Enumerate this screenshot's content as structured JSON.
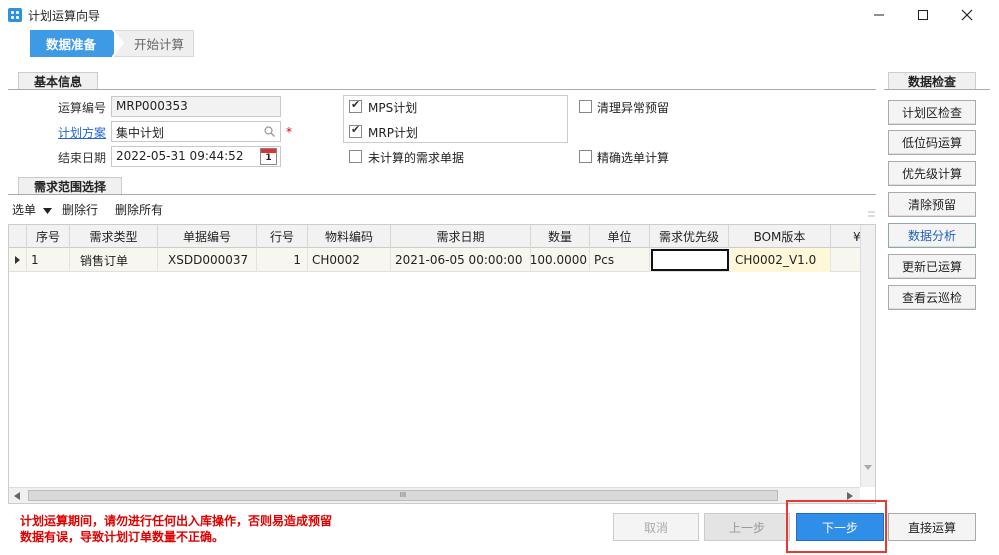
{
  "window": {
    "title": "计划运算向导",
    "min_icon": "minimize-icon",
    "max_icon": "maximize-icon",
    "close_icon": "close-icon"
  },
  "wizard": {
    "steps": [
      {
        "label": "数据准备",
        "active": true
      },
      {
        "label": "开始计算",
        "active": false
      }
    ]
  },
  "basic": {
    "section_title": "基本信息",
    "calc_no_label": "运算编号",
    "calc_no_value": "MRP000353",
    "plan_label": "计划方案",
    "plan_value": "集中计划",
    "required_mark": "*",
    "end_date_label": "结束日期",
    "end_date_value": "2022-05-31 09:44:52",
    "calendar_day": "1",
    "options": {
      "mps": {
        "label": "MPS计划",
        "checked": true
      },
      "mrp": {
        "label": "MRP计划",
        "checked": true
      },
      "uncalc": {
        "label": "未计算的需求单据",
        "checked": false
      },
      "clear_abnormal": {
        "label": "清理异常预留",
        "checked": false
      },
      "precise": {
        "label": "精确选单计算",
        "checked": false
      }
    }
  },
  "demand": {
    "section_title": "需求范围选择",
    "toolbar": {
      "select": "选单",
      "delete_row": "删除行",
      "delete_all": "删除所有"
    },
    "columns": [
      "序号",
      "需求类型",
      "单据编号",
      "行号",
      "物料编码",
      "需求日期",
      "数量",
      "单位",
      "需求优先级",
      "BOM版本",
      "¥"
    ],
    "rows": [
      {
        "seq": "1",
        "type": "销售订单",
        "doc_no": "XSDD000037",
        "line": "1",
        "material": "CH0002",
        "date": "2021-06-05 00:00:00",
        "qty": "100.0000",
        "unit": "Pcs",
        "priority": "",
        "bom": "CH0002_V1.0"
      }
    ],
    "hscroll_grip": "III"
  },
  "check": {
    "section_title": "数据检查",
    "buttons": [
      "计划区检查",
      "低位码运算",
      "优先级计算",
      "清除预留",
      "数据分析",
      "更新已运算",
      "查看云巡检"
    ]
  },
  "footer": {
    "warning": "计划运算期间，请勿进行任何出入库操作，否则易造成预留数据有误，导致计划订单数量不正确。",
    "cancel": "取消",
    "prev": "上一步",
    "next": "下一步",
    "direct": "直接运算"
  },
  "colors": {
    "accent": "#3e9ae4",
    "next_btn": "#2f8fe8",
    "highlight_box": "#e53935",
    "warning": "#e00000",
    "link": "#2266cc",
    "bom_cell": "#fff8d8"
  }
}
